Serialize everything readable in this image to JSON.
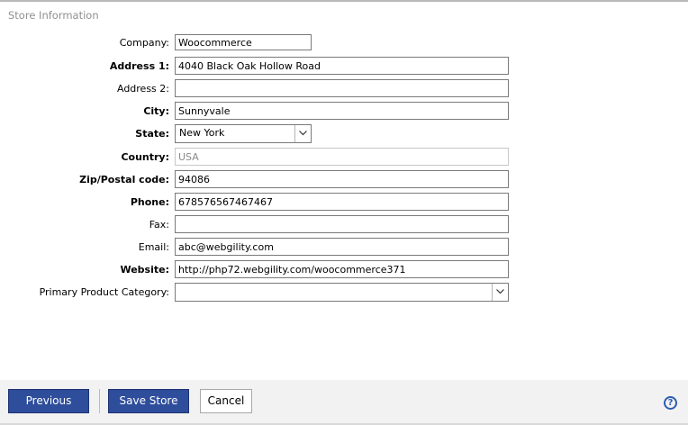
{
  "section": {
    "title": "Store Information"
  },
  "form": {
    "company": {
      "label": "Company:",
      "value": "Woocommerce"
    },
    "address1": {
      "label": "Address 1:",
      "value": "4040 Black Oak Hollow Road"
    },
    "address2": {
      "label": "Address 2:",
      "value": ""
    },
    "city": {
      "label": "City:",
      "value": "Sunnyvale"
    },
    "state": {
      "label": "State:",
      "value": "New York"
    },
    "country": {
      "label": "Country:",
      "value": "USA"
    },
    "zip": {
      "label": "Zip/Postal code:",
      "value": "94086"
    },
    "phone": {
      "label": "Phone:",
      "value": "678576567467467"
    },
    "fax": {
      "label": "Fax:",
      "value": ""
    },
    "email": {
      "label": "Email:",
      "value": "abc@webgility.com"
    },
    "website": {
      "label": "Website:",
      "value": "http://php72.webgility.com/woocommerce371"
    },
    "category": {
      "label": "Primary Product Category:",
      "value": ""
    }
  },
  "footer": {
    "previous_label": "Previous",
    "save_label": "Save Store",
    "cancel_label": "Cancel",
    "help_glyph": "?"
  }
}
